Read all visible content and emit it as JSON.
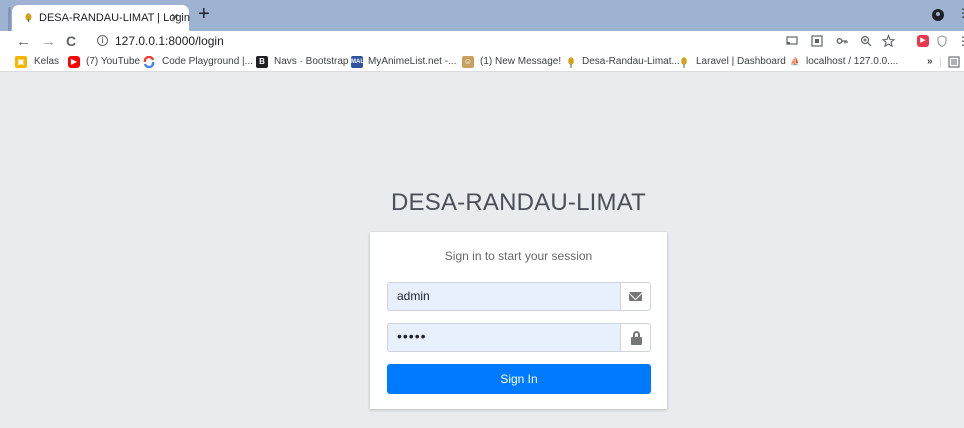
{
  "browser": {
    "tab": {
      "title": "DESA-RANDAU-LIMAT | Login",
      "close": "×"
    },
    "new_tab": "+",
    "nav": {
      "back": "←",
      "forward": "→",
      "reload": "C"
    },
    "url": "127.0.0.1:8000/login",
    "toolbar_icons": [
      "cast-icon",
      "qr-icon",
      "key-icon",
      "zoom-icon",
      "star-icon",
      "extension-red-icon",
      "shield-icon",
      "more-icon"
    ],
    "bookmarks": [
      {
        "label": "Kelas",
        "icon": "classroom-icon",
        "color": "#f4b400"
      },
      {
        "label": "(7) YouTube",
        "icon": "youtube-icon",
        "color": "#ff0000"
      },
      {
        "label": "Code Playground |...",
        "icon": "codeplayground-icon",
        "color": "#4285f4"
      },
      {
        "label": "Navs · Bootstrap",
        "icon": "bootstrap-icon",
        "color": "#202124"
      },
      {
        "label": "MyAnimeList.net -...",
        "icon": "mal-icon",
        "color": "#2e51a2"
      },
      {
        "label": "(1) New Message!",
        "icon": "message-icon",
        "color": "#c8a060"
      },
      {
        "label": "Desa-Randau-Limat...",
        "icon": "desa-icon",
        "color": "#d4a017"
      },
      {
        "label": "Laravel | Dashboard",
        "icon": "laravel-icon",
        "color": "#d4a017"
      },
      {
        "label": "localhost / 127.0.0....",
        "icon": "phpmyadmin-icon",
        "color": "#f29111"
      }
    ],
    "bookmarks_overflow": "»"
  },
  "login": {
    "brand": "DESA-RANDAU-LIMAT",
    "message": "Sign in to start your session",
    "username": "admin",
    "password": "•••••",
    "submit": "Sign In"
  },
  "colors": {
    "primary": "#007bff",
    "page_bg": "#e9ecef",
    "autofill_bg": "#e8f0fe",
    "tabbar": "#9db3d1"
  }
}
